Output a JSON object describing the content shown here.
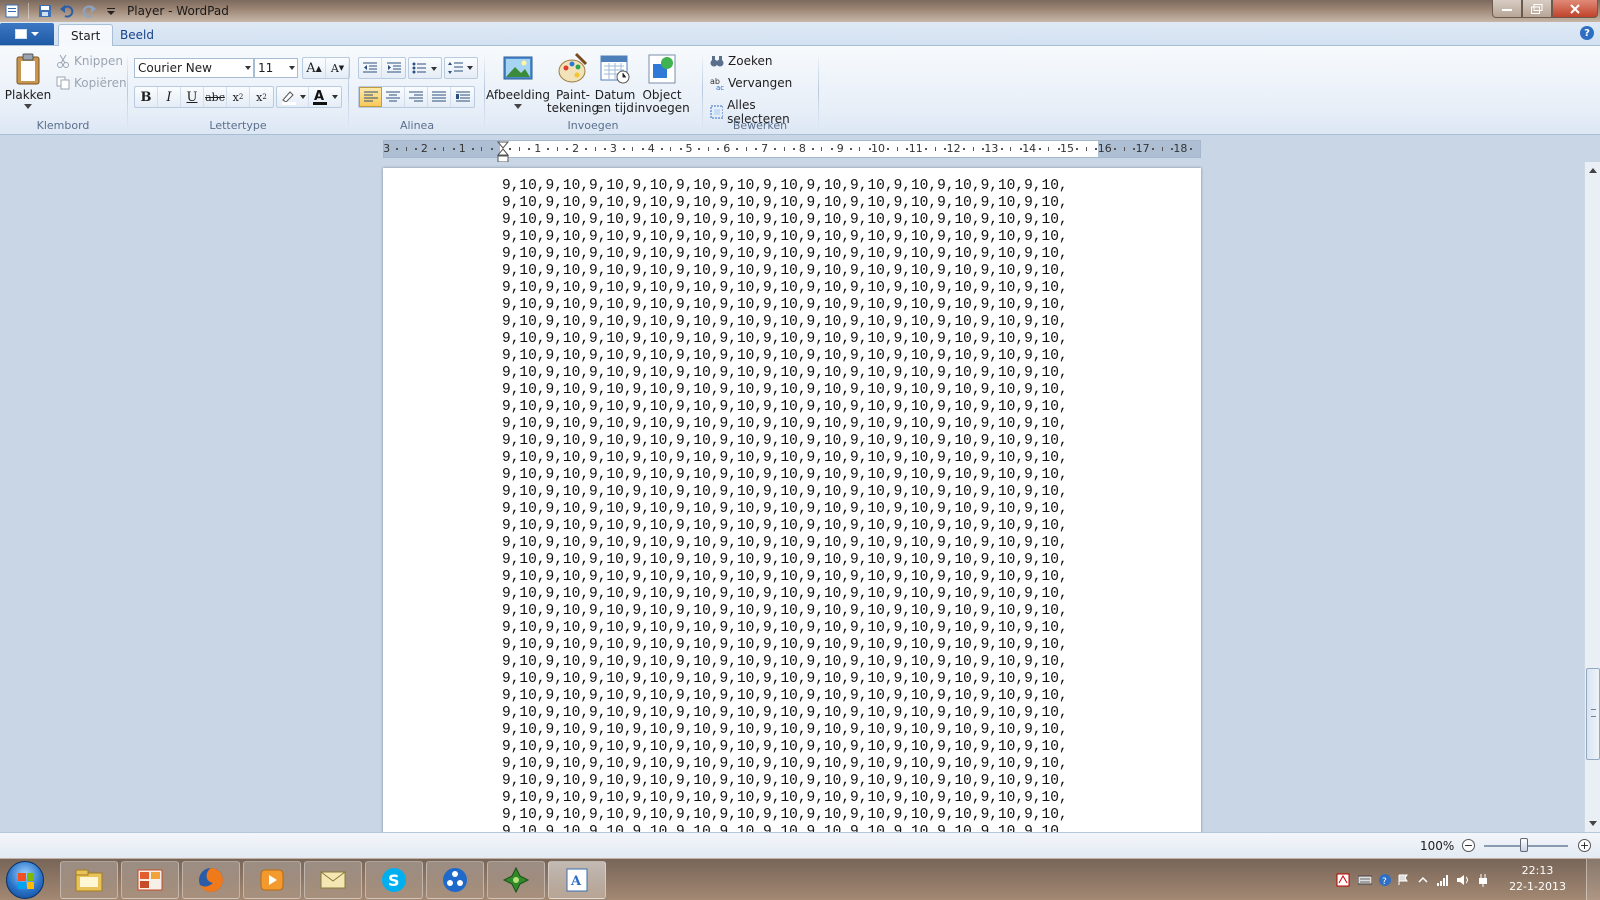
{
  "window": {
    "title": "Player - WordPad"
  },
  "tabs": [
    {
      "label": "Start"
    },
    {
      "label": "Beeld"
    }
  ],
  "clipboard": {
    "paste": "Plakken",
    "cut": "Knippen",
    "copy": "Kopiëren",
    "group": "Klembord"
  },
  "font": {
    "name": "Courier New",
    "size": "11",
    "group": "Lettertype"
  },
  "paragraph": {
    "group": "Alinea"
  },
  "insert": {
    "picture": "Afbeelding",
    "paint_1": "Paint-",
    "paint_2": "tekening",
    "datetime_1": "Datum",
    "datetime_2": "en tijd",
    "object_1": "Object",
    "object_2": "invoegen",
    "group": "Invoegen"
  },
  "edit": {
    "find": "Zoeken",
    "replace": "Vervangen",
    "select_all": "Alles selecteren",
    "group": "Bewerken"
  },
  "ruler": {
    "labels": [
      "3",
      "2",
      "1",
      "1",
      "2",
      "3",
      "4",
      "5",
      "6",
      "7",
      "8",
      "9",
      "10",
      "11",
      "12",
      "13",
      "14",
      "15",
      "16",
      "17",
      "18"
    ]
  },
  "document": {
    "line": "9,10,9,10,9,10,9,10,9,10,9,10,9,10,9,10,9,10,9,10,9,10,9,10,9,10,",
    "line_count": 39
  },
  "statusbar": {
    "zoom": "100%"
  },
  "taskbar": {
    "time": "22:13",
    "date": "22-1-2013"
  },
  "colors": {
    "accent": "#2b6cc4",
    "selected_button": "#f8c95a"
  }
}
